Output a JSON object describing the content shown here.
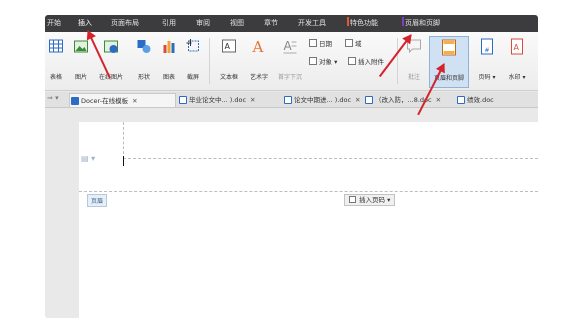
{
  "menubar": {
    "items": [
      "开始",
      "插入",
      "页面布局",
      "引用",
      "审阅",
      "视图",
      "章节",
      "开发工具",
      "特色功能",
      "页眉和页脚"
    ],
    "active_index": 1,
    "special_colors": {
      "特色功能": "#e05a2b",
      "页眉和页脚": "#7b3fbf"
    }
  },
  "ribbon": {
    "buttons": {
      "table": "表格",
      "picture": "图片",
      "online_picture": "在线图片",
      "shape": "形状",
      "chart": "图表",
      "screenshot": "截屏",
      "textbox": "文本框",
      "wordart": "艺术字",
      "drop_cap": "首字下沉",
      "header_footer": "页眉和页脚",
      "page_number": "页码",
      "watermark": "水印",
      "comment": "批注"
    },
    "small": {
      "date": "日期",
      "field": "域",
      "object": "对象",
      "attachment": "插入附件"
    }
  },
  "tabs": [
    {
      "label": "Docer-在线模板",
      "icon_color": "#2d6cc4"
    },
    {
      "label": "毕业论文中... ).doc",
      "icon_color": "#2d6cc4"
    },
    {
      "label": "论文中期进... ).doc",
      "icon_color": "#2d6cc4"
    },
    {
      "label": "（改入防，...8.doc",
      "icon_color": "#2d6cc4"
    },
    {
      "label": "绩效.doc",
      "icon_color": "#2d6cc4"
    }
  ],
  "document": {
    "header_tag": "页眉",
    "insert_page_number": "插入页码"
  },
  "colors": {
    "accent": "#d4232a",
    "menubar": "#3c3c3e",
    "selected": "#cfe1f3"
  }
}
